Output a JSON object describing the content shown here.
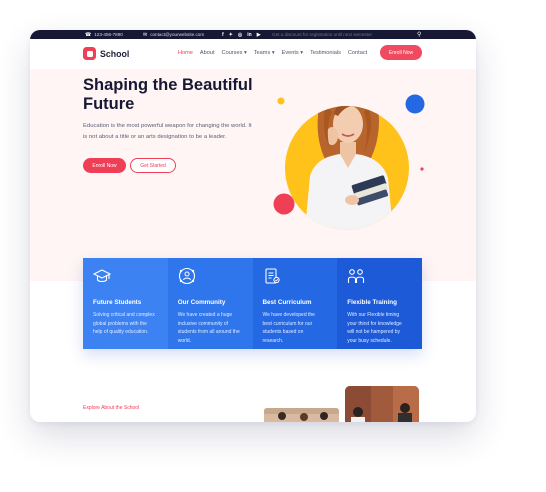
{
  "topbar": {
    "phone": "123-456-7890",
    "email": "contact@yourwebsite.com",
    "social": [
      "f",
      "t",
      "ig",
      "in",
      "yt"
    ],
    "promo": "Get a discount for registration until next semester",
    "search_icon": "search-icon"
  },
  "brand": {
    "name": "School",
    "color": "#ef3f57"
  },
  "nav": {
    "items": [
      {
        "label": "Home"
      },
      {
        "label": "About"
      },
      {
        "label": "Courses"
      },
      {
        "label": "Teams"
      },
      {
        "label": "Events"
      },
      {
        "label": "Testimonials"
      },
      {
        "label": "Contact"
      }
    ],
    "cta": "Enroll Now"
  },
  "hero": {
    "title": "Shaping the Beautiful Future",
    "text": "Education is the most powerful weapon for changing the world. It is not about a title or an arts designation to be a leader.",
    "primary_button": "Enroll Now",
    "secondary_button": "Get Started"
  },
  "features": [
    {
      "icon": "graduation-cap-icon",
      "title": "Future Students",
      "text": "Solving critical and complex global problems with the help of quality education.",
      "color": "#3c82f2"
    },
    {
      "icon": "community-network-icon",
      "title": "Our Community",
      "text": "We have created a huge inclusive community of students from all around the world.",
      "color": "#2f76ec"
    },
    {
      "icon": "curriculum-document-icon",
      "title": "Best Curriculum",
      "text": "We have developed the best curriculum for our students based on research.",
      "color": "#2468e3"
    },
    {
      "icon": "training-people-icon",
      "title": "Flexible Training",
      "text": "With our Flexible timing your thirst for knowledge will not be hampered by your busy schedule.",
      "color": "#1c5ad8"
    }
  ],
  "about": {
    "eyebrow": "Explore About the School"
  },
  "colors": {
    "accent": "#ef3f57",
    "dark": "#171833",
    "hero_bg": "#fff5f4",
    "circle": "#ffc21a",
    "blue": "#2468e3"
  }
}
